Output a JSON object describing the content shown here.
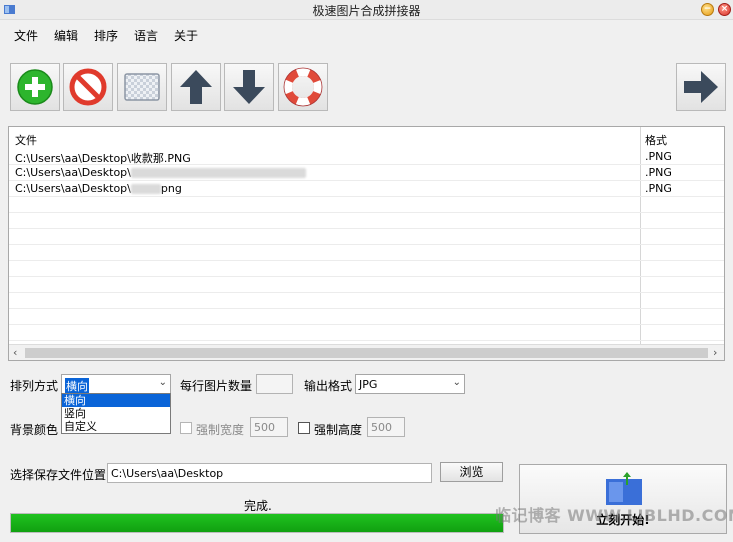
{
  "window": {
    "title": "极速图片合成拼接器",
    "icon": "app-icon"
  },
  "menu": [
    "文件",
    "编辑",
    "排序",
    "语言",
    "关于"
  ],
  "toolbar": [
    {
      "name": "add-button",
      "icon": "add-icon",
      "color": "#2db52d"
    },
    {
      "name": "remove-button",
      "icon": "forbidden-icon",
      "color": "#e03a2c"
    },
    {
      "name": "clear-button",
      "icon": "checkerboard-icon",
      "color": "#cfd6e0"
    },
    {
      "name": "move-up-button",
      "icon": "arrow-up-icon",
      "color": "#3b4a5c"
    },
    {
      "name": "move-down-button",
      "icon": "arrow-down-icon",
      "color": "#3b4a5c"
    },
    {
      "name": "help-button",
      "icon": "lifebuoy-icon",
      "color": "#e04a3a"
    },
    {
      "name": "next-button",
      "icon": "arrow-right-icon",
      "color": "#3b4a5c"
    }
  ],
  "filelist": {
    "headers": [
      "文件",
      "格式"
    ],
    "rows": [
      {
        "file": "C:\\Users\\aa\\Desktop\\收款那.PNG",
        "format": ".PNG"
      },
      {
        "file": "C:\\Users\\aa\\Desktop\\",
        "format": ".PNG"
      },
      {
        "file": "C:\\Users\\aa\\Desktop\\",
        "file_suffix": "png",
        "format": ".PNG"
      }
    ]
  },
  "settings": {
    "arrange_label": "排列方式",
    "arrange_value": "横向",
    "arrange_options": [
      "横向",
      "竖向",
      "自定义"
    ],
    "per_row_label": "每行图片数量",
    "per_row_value": "",
    "output_label": "输出格式",
    "output_value": "JPG",
    "bg_label": "背景颜色",
    "force_width_label": "强制宽度",
    "force_width_value": "500",
    "force_height_label": "强制高度",
    "force_height_value": "500",
    "save_label": "选择保存文件位置",
    "save_path": "C:\\Users\\aa\\Desktop",
    "browse_label": "浏览"
  },
  "status": {
    "text": "完成.",
    "progress": 1.0,
    "progress_color": "#16b016"
  },
  "start_button": {
    "label": "立刻开始!"
  },
  "watermark": "临记博客 WWW.LJBLHD.COM"
}
